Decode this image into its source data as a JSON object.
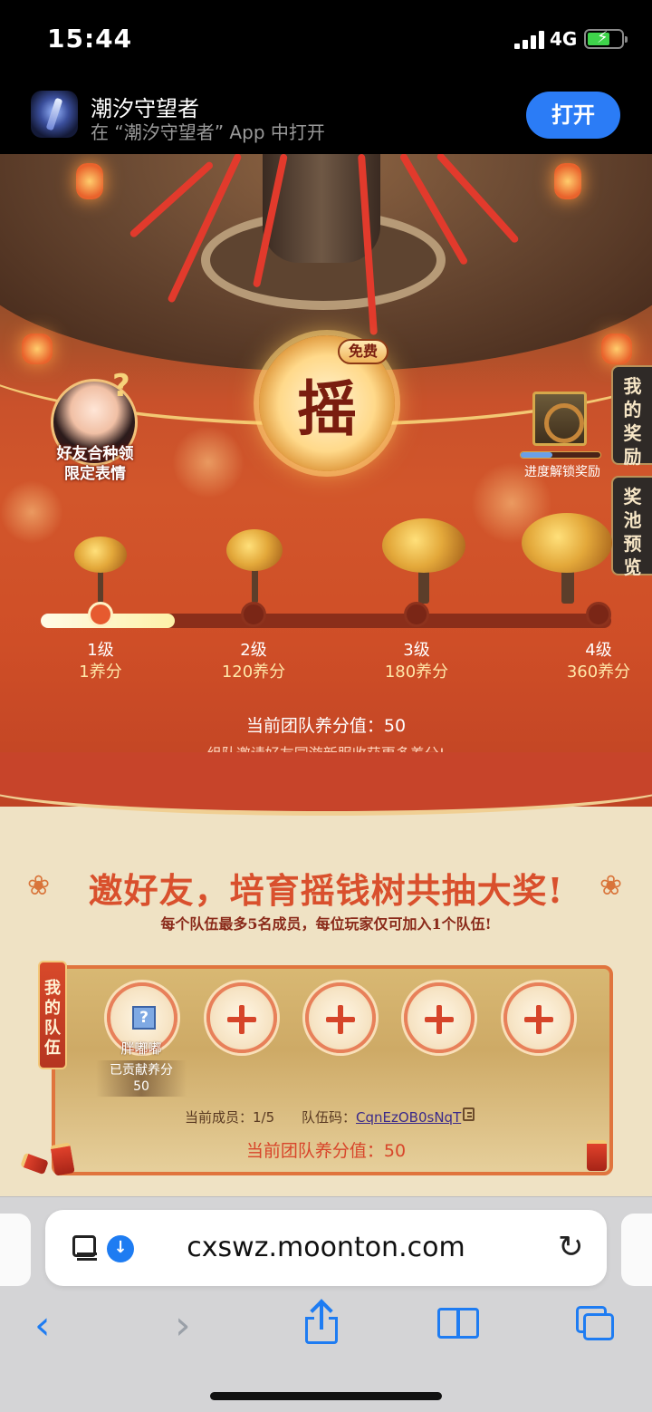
{
  "status_bar": {
    "time": "15:44",
    "network": "4G",
    "battery_charging": true
  },
  "app_banner": {
    "app_name": "潮汐守望者",
    "subtitle": "在 “潮汐守望者” App 中打开",
    "open_label": "打开"
  },
  "game": {
    "shake_label": "摇",
    "free_badge": "免费",
    "friend_feature": {
      "line1": "好友合种领",
      "line2": "限定表情"
    },
    "progress_reward_label": "进度解锁奖励",
    "side_tabs": {
      "my_rewards": "我的奖励",
      "pool_preview": "奖池预览"
    },
    "levels": [
      {
        "label": "1级",
        "score": "1养分"
      },
      {
        "label": "2级",
        "score": "120养分"
      },
      {
        "label": "3级",
        "score": "180养分"
      },
      {
        "label": "4级",
        "score": "360养分"
      }
    ],
    "progress_fraction": 0.235,
    "team_score_text": "当前团队养分值：50",
    "invite_hint": "组队邀请好友同游新服收获更多养分!",
    "headline": "邀好友，培育摇钱树共抽大奖!",
    "subline": "每个队伍最多5名成员，每位玩家仅可加入1个队伍!",
    "team": {
      "tag": "我的队伍",
      "member": {
        "name": "胖嘟嘟",
        "contrib_label": "已贡献养分",
        "contrib_value": "50",
        "icon": "?"
      },
      "empty_slots": 4,
      "members_text": "当前成员：1/5",
      "code_label": "队伍码：",
      "code": "CqnEzOB0sNqT",
      "score_text": "当前团队养分值：50"
    }
  },
  "browser": {
    "url": "cxswz.moonton.com",
    "icons": [
      "reader-icon",
      "download-icon",
      "reload-icon",
      "back-icon",
      "forward-icon",
      "share-icon",
      "bookmarks-icon",
      "tabs-icon"
    ]
  },
  "colors": {
    "accent_blue": "#2b7cf6",
    "theme_red": "#d9502d",
    "gold": "#f3c873"
  }
}
